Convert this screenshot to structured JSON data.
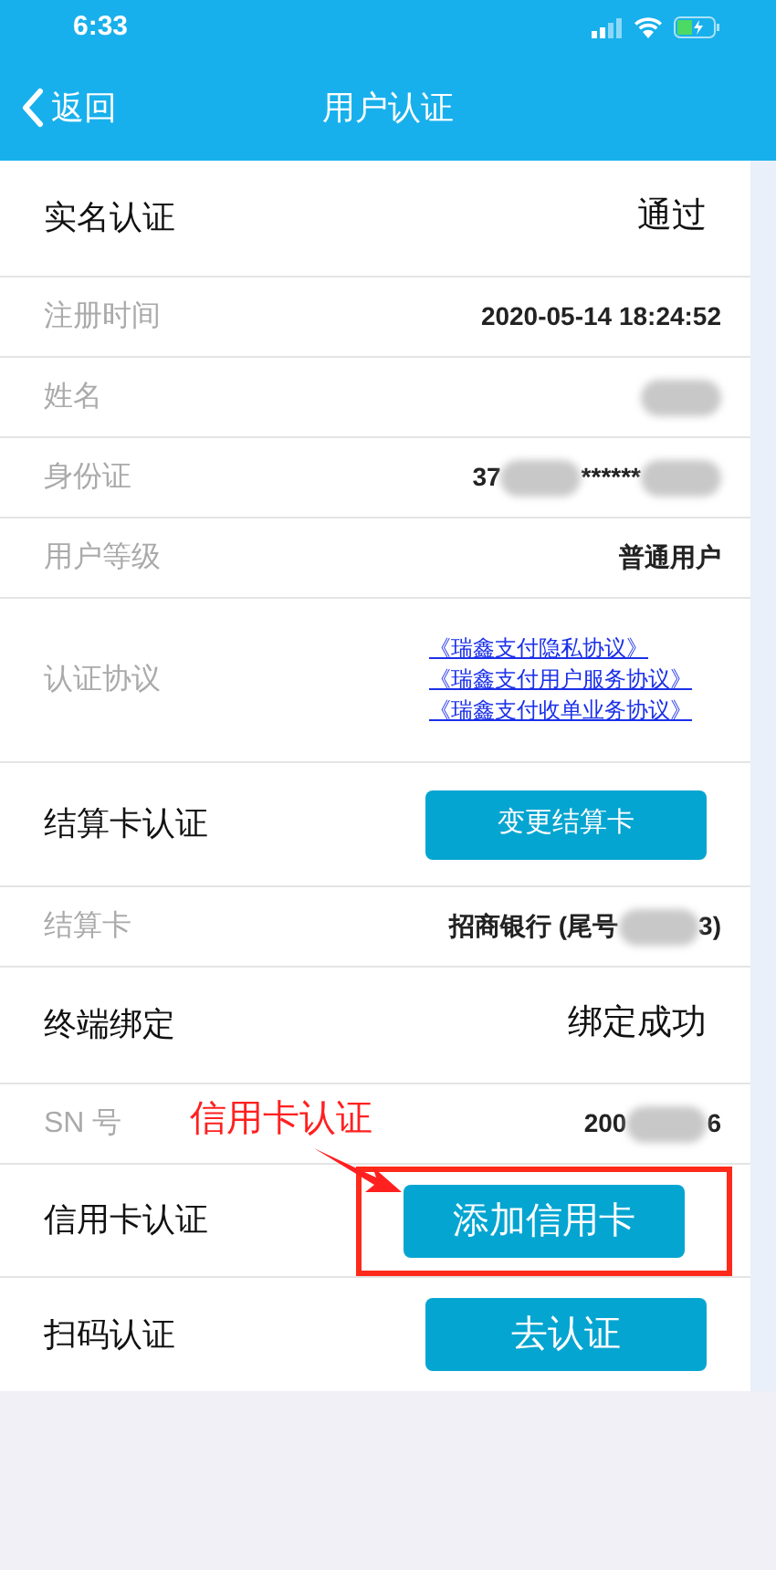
{
  "status_bar": {
    "time": "6:33"
  },
  "nav": {
    "back": "返回",
    "title": "用户认证"
  },
  "rows": [
    {
      "kind": "header",
      "label": "实名认证",
      "value": [
        {
          "text": "通过"
        }
      ]
    },
    {
      "kind": "detail",
      "label": "注册时间",
      "value": [
        {
          "text": "2020-05-14 18:24:52"
        }
      ]
    },
    {
      "kind": "detail",
      "label": "姓名",
      "value": [
        {
          "kind": "blur"
        }
      ]
    },
    {
      "kind": "detail",
      "label": "身份证",
      "value": [
        {
          "text": "37"
        },
        {
          "kind": "blur"
        },
        {
          "text": "******"
        },
        {
          "kind": "blur"
        }
      ]
    },
    {
      "kind": "detail",
      "label": "用户等级",
      "value": [
        {
          "text": "普通用户"
        }
      ]
    },
    {
      "kind": "links",
      "label": "认证协议",
      "links": [
        "《瑞鑫支付隐私协议》",
        "《瑞鑫支付用户服务协议》",
        "《瑞鑫支付收单业务协议》"
      ]
    },
    {
      "kind": "small_button",
      "label": "结算卡认证",
      "button": "变更结算卡",
      "highlighted": false
    },
    {
      "kind": "detail",
      "label": "结算卡",
      "value": [
        {
          "text": "招商银行 (尾号"
        },
        {
          "kind": "blur"
        },
        {
          "text": "3)"
        }
      ]
    },
    {
      "kind": "header",
      "label": "终端绑定",
      "value": [
        {
          "text": "绑定成功"
        }
      ]
    },
    {
      "kind": "detail",
      "label": "SN 号",
      "value": [
        {
          "text": "200"
        },
        {
          "kind": "blur"
        },
        {
          "text": "6"
        }
      ]
    },
    {
      "kind": "button",
      "label": "信用卡认证",
      "button": "添加信用卡",
      "highlighted": true
    },
    {
      "kind": "button",
      "label": "扫码认证",
      "button": "去认证",
      "highlighted": false
    }
  ],
  "annotation": {
    "text": "信用卡认证"
  }
}
